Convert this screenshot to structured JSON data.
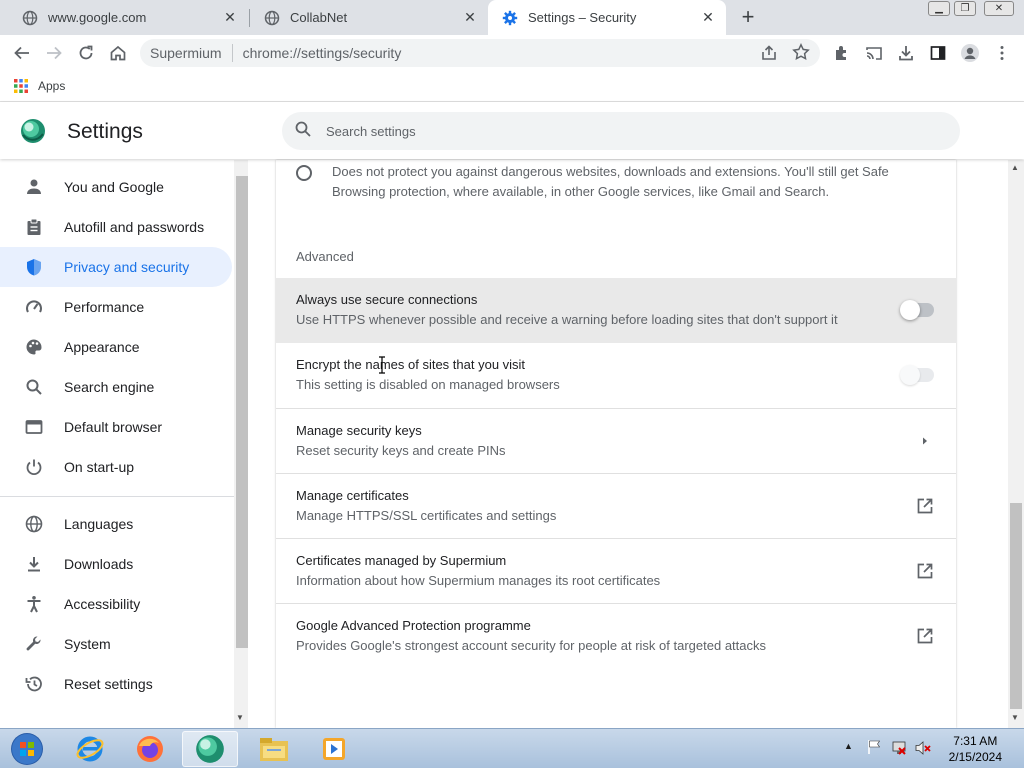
{
  "tabs": [
    {
      "title": "www.google.com",
      "icon": "globe-icon"
    },
    {
      "title": "CollabNet",
      "icon": "globe-icon"
    },
    {
      "title": "Settings – Security",
      "icon": "gear-icon",
      "active": true
    }
  ],
  "omnibox": {
    "site_name": "Supermium",
    "url": "chrome://settings/security"
  },
  "bookmarks": {
    "apps_label": "Apps"
  },
  "settings": {
    "title": "Settings",
    "search_placeholder": "Search settings"
  },
  "sidebar": {
    "items": [
      {
        "label": "You and Google",
        "icon": "person-icon"
      },
      {
        "label": "Autofill and passwords",
        "icon": "clipboard-icon"
      },
      {
        "label": "Privacy and security",
        "icon": "shield-icon",
        "active": true
      },
      {
        "label": "Performance",
        "icon": "speedometer-icon"
      },
      {
        "label": "Appearance",
        "icon": "palette-icon"
      },
      {
        "label": "Search engine",
        "icon": "search-icon"
      },
      {
        "label": "Default browser",
        "icon": "browser-window-icon"
      },
      {
        "label": "On start-up",
        "icon": "power-icon"
      },
      {
        "label": "Languages",
        "icon": "globe-icon"
      },
      {
        "label": "Downloads",
        "icon": "download-icon"
      },
      {
        "label": "Accessibility",
        "icon": "accessibility-icon"
      },
      {
        "label": "System",
        "icon": "wrench-icon"
      },
      {
        "label": "Reset settings",
        "icon": "history-icon"
      }
    ]
  },
  "main": {
    "no_protection_desc": "Does not protect you against dangerous websites, downloads and extensions. You'll still get Safe Browsing protection, where available, in other Google services, like Gmail and Search.",
    "advanced_heading": "Advanced",
    "rows": [
      {
        "title": "Always use secure connections",
        "subtitle": "Use HTTPS whenever possible and receive a warning before loading sites that don't support it",
        "control": "toggle",
        "state": "off"
      },
      {
        "title": "Encrypt the names of sites that you visit",
        "subtitle": "This setting is disabled on managed browsers",
        "control": "toggle",
        "state": "disabled"
      },
      {
        "title": "Manage security keys",
        "subtitle": "Reset security keys and create PINs",
        "control": "chevron-right-icon"
      },
      {
        "title": "Manage certificates",
        "subtitle": "Manage HTTPS/SSL certificates and settings",
        "control": "external-link-icon"
      },
      {
        "title": "Certificates managed by Supermium",
        "subtitle": "Information about how Supermium manages its root certificates",
        "control": "external-link-icon"
      },
      {
        "title": "Google Advanced Protection programme",
        "subtitle": "Provides Google's strongest account security for people at risk of targeted attacks",
        "control": "external-link-icon"
      }
    ]
  },
  "taskbar": {
    "apps": [
      "start-orb-icon",
      "internet-explorer-icon",
      "firefox-icon",
      "supermium-icon",
      "file-explorer-icon",
      "media-player-icon"
    ],
    "time": "7:31 AM",
    "date": "2/15/2024"
  },
  "colors": {
    "accent": "#1a73e8",
    "active_nav_bg": "#e8f0fe",
    "tabstrip_bg": "#dee1e6"
  }
}
